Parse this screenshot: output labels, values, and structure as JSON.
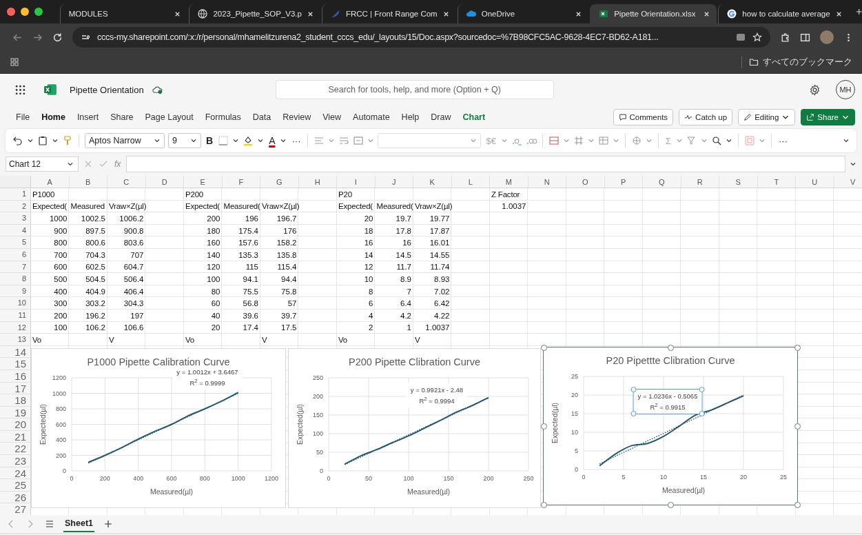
{
  "browser": {
    "tabs": [
      {
        "title": "MODULES",
        "kind": "blank",
        "selected": false
      },
      {
        "title": "2023_Pipette_SOP_V3.p",
        "kind": "globe",
        "selected": false
      },
      {
        "title": "FRCC | Front Range Com",
        "kind": "feather",
        "selected": false
      },
      {
        "title": "OneDrive",
        "kind": "cloud",
        "selected": false
      },
      {
        "title": "Pipette Orientation.xlsx",
        "kind": "excel",
        "selected": true
      },
      {
        "title": "how to calculate average",
        "kind": "google",
        "selected": false
      }
    ],
    "address": "cccs-my.sharepoint.com/:x:/r/personal/mhamelitzurena2_student_cccs_edu/_layouts/15/Doc.aspx?sourcedoc=%7B98CFC5AC-9628-4EC7-BD62-A181...",
    "bookmarks_label": "すべてのブックマーク"
  },
  "app": {
    "doc_title": "Pipette Orientation",
    "search": {
      "placeholder": "Search for tools, help, and more (Option + Q)"
    },
    "avatar": "MH",
    "menu": [
      {
        "label": "File",
        "kind": "plain",
        "selected": false
      },
      {
        "label": "Home",
        "kind": "plain",
        "selected": true
      },
      {
        "label": "Insert",
        "kind": "plain",
        "selected": false
      },
      {
        "label": "Share",
        "kind": "plain",
        "selected": false
      },
      {
        "label": "Page Layout",
        "kind": "plain",
        "selected": false
      },
      {
        "label": "Formulas",
        "kind": "plain",
        "selected": false
      },
      {
        "label": "Data",
        "kind": "plain",
        "selected": false
      },
      {
        "label": "Review",
        "kind": "plain",
        "selected": false
      },
      {
        "label": "View",
        "kind": "plain",
        "selected": false
      },
      {
        "label": "Automate",
        "kind": "plain",
        "selected": false
      },
      {
        "label": "Help",
        "kind": "plain",
        "selected": false
      },
      {
        "label": "Draw",
        "kind": "plain",
        "selected": false
      },
      {
        "label": "Chart",
        "kind": "contextual",
        "selected": false
      }
    ],
    "actions": {
      "comments": "Comments",
      "catch_up": "Catch up",
      "editing": "Editing",
      "share": "Share"
    },
    "ribbon": {
      "font": "Aptos Narrow",
      "size": "9",
      "bold_label": "B",
      "font_color_label": "A",
      "more_label": "···",
      "currency_label": "$€",
      "sum_label": "Σ",
      "more_label_end": "···"
    },
    "formula_bar": {
      "name_box": "Chart 12",
      "fx_label": "fx"
    }
  },
  "sheet": {
    "columns": [
      "A",
      "B",
      "C",
      "D",
      "E",
      "F",
      "G",
      "H",
      "I",
      "J",
      "K",
      "L",
      "M",
      "N",
      "O",
      "P",
      "Q",
      "R",
      "S",
      "T",
      "U",
      "V"
    ],
    "rows": [
      {
        "number": "1",
        "cells": [
          {
            "text": "P1000",
            "kind": "text"
          },
          null,
          null,
          null,
          {
            "text": "P200",
            "kind": "text"
          },
          null,
          null,
          null,
          {
            "text": "P20",
            "kind": "text"
          },
          null,
          null,
          null,
          {
            "text": "Z Factor",
            "kind": "text"
          }
        ]
      },
      {
        "number": "2",
        "cells": [
          {
            "text": "Expected(",
            "kind": "text"
          },
          {
            "text": "Measured",
            "kind": "text"
          },
          {
            "text": "Vraw×Z(µl)",
            "kind": "text"
          },
          null,
          {
            "text": "Expected(",
            "kind": "text"
          },
          {
            "text": "Measured(",
            "kind": "text"
          },
          {
            "text": "Vraw×Z(µl)",
            "kind": "text"
          },
          null,
          {
            "text": "Expected(",
            "kind": "text"
          },
          {
            "text": "Measured(",
            "kind": "text"
          },
          {
            "text": "Vraw×Z(µl)",
            "kind": "text"
          },
          null,
          {
            "text": "1.0037",
            "kind": "number"
          }
        ]
      },
      {
        "number": "3",
        "cells": [
          {
            "text": "1000",
            "kind": "number"
          },
          {
            "text": "1002.5",
            "kind": "number"
          },
          {
            "text": "1006.2",
            "kind": "number"
          },
          null,
          {
            "text": "200",
            "kind": "number"
          },
          {
            "text": "196",
            "kind": "number"
          },
          {
            "text": "196.7",
            "kind": "number"
          },
          null,
          {
            "text": "20",
            "kind": "number"
          },
          {
            "text": "19.7",
            "kind": "number"
          },
          {
            "text": "19.77",
            "kind": "number"
          }
        ]
      },
      {
        "number": "4",
        "cells": [
          {
            "text": "900",
            "kind": "number"
          },
          {
            "text": "897.5",
            "kind": "number"
          },
          {
            "text": "900.8",
            "kind": "number"
          },
          null,
          {
            "text": "180",
            "kind": "number"
          },
          {
            "text": "175.4",
            "kind": "number"
          },
          {
            "text": "176",
            "kind": "number"
          },
          null,
          {
            "text": "18",
            "kind": "number"
          },
          {
            "text": "17.8",
            "kind": "number"
          },
          {
            "text": "17.87",
            "kind": "number"
          }
        ]
      },
      {
        "number": "5",
        "cells": [
          {
            "text": "800",
            "kind": "number"
          },
          {
            "text": "800.6",
            "kind": "number"
          },
          {
            "text": "803.6",
            "kind": "number"
          },
          null,
          {
            "text": "160",
            "kind": "number"
          },
          {
            "text": "157.6",
            "kind": "number"
          },
          {
            "text": "158.2",
            "kind": "number"
          },
          null,
          {
            "text": "16",
            "kind": "number"
          },
          {
            "text": "16",
            "kind": "number"
          },
          {
            "text": "16.01",
            "kind": "number"
          }
        ]
      },
      {
        "number": "6",
        "cells": [
          {
            "text": "700",
            "kind": "number"
          },
          {
            "text": "704.3",
            "kind": "number"
          },
          {
            "text": "707",
            "kind": "number"
          },
          null,
          {
            "text": "140",
            "kind": "number"
          },
          {
            "text": "135.3",
            "kind": "number"
          },
          {
            "text": "135.8",
            "kind": "number"
          },
          null,
          {
            "text": "14",
            "kind": "number"
          },
          {
            "text": "14.5",
            "kind": "number"
          },
          {
            "text": "14.55",
            "kind": "number"
          }
        ]
      },
      {
        "number": "7",
        "cells": [
          {
            "text": "600",
            "kind": "number"
          },
          {
            "text": "602.5",
            "kind": "number"
          },
          {
            "text": "604.7",
            "kind": "number"
          },
          null,
          {
            "text": "120",
            "kind": "number"
          },
          {
            "text": "115",
            "kind": "number"
          },
          {
            "text": "115.4",
            "kind": "number"
          },
          null,
          {
            "text": "12",
            "kind": "number"
          },
          {
            "text": "11.7",
            "kind": "number"
          },
          {
            "text": "11.74",
            "kind": "number"
          }
        ]
      },
      {
        "number": "8",
        "cells": [
          {
            "text": "500",
            "kind": "number"
          },
          {
            "text": "504.5",
            "kind": "number"
          },
          {
            "text": "506.4",
            "kind": "number"
          },
          null,
          {
            "text": "100",
            "kind": "number"
          },
          {
            "text": "94.1",
            "kind": "number"
          },
          {
            "text": "94.4",
            "kind": "number"
          },
          null,
          {
            "text": "10",
            "kind": "number"
          },
          {
            "text": "8.9",
            "kind": "number"
          },
          {
            "text": "8.93",
            "kind": "number"
          }
        ]
      },
      {
        "number": "9",
        "cells": [
          {
            "text": "400",
            "kind": "number"
          },
          {
            "text": "404.9",
            "kind": "number"
          },
          {
            "text": "406.4",
            "kind": "number"
          },
          null,
          {
            "text": "80",
            "kind": "number"
          },
          {
            "text": "75.5",
            "kind": "number"
          },
          {
            "text": "75.8",
            "kind": "number"
          },
          null,
          {
            "text": "8",
            "kind": "number"
          },
          {
            "text": "7",
            "kind": "number"
          },
          {
            "text": "7.02",
            "kind": "number"
          }
        ]
      },
      {
        "number": "10",
        "cells": [
          {
            "text": "300",
            "kind": "number"
          },
          {
            "text": "303.2",
            "kind": "number"
          },
          {
            "text": "304.3",
            "kind": "number"
          },
          null,
          {
            "text": "60",
            "kind": "number"
          },
          {
            "text": "56.8",
            "kind": "number"
          },
          {
            "text": "57",
            "kind": "number"
          },
          null,
          {
            "text": "6",
            "kind": "number"
          },
          {
            "text": "6.4",
            "kind": "number"
          },
          {
            "text": "6.42",
            "kind": "number"
          }
        ]
      },
      {
        "number": "11",
        "cells": [
          {
            "text": "200",
            "kind": "number"
          },
          {
            "text": "196.2",
            "kind": "number"
          },
          {
            "text": "197",
            "kind": "number"
          },
          null,
          {
            "text": "40",
            "kind": "number"
          },
          {
            "text": "39.6",
            "kind": "number"
          },
          {
            "text": "39.7",
            "kind": "number"
          },
          null,
          {
            "text": "4",
            "kind": "number"
          },
          {
            "text": "4.2",
            "kind": "number"
          },
          {
            "text": "4.22",
            "kind": "number"
          }
        ]
      },
      {
        "number": "12",
        "cells": [
          {
            "text": "100",
            "kind": "number"
          },
          {
            "text": "106.2",
            "kind": "number"
          },
          {
            "text": "106.6",
            "kind": "number"
          },
          null,
          {
            "text": "20",
            "kind": "number"
          },
          {
            "text": "17.4",
            "kind": "number"
          },
          {
            "text": "17.5",
            "kind": "number"
          },
          null,
          {
            "text": "2",
            "kind": "number"
          },
          {
            "text": "1",
            "kind": "number"
          },
          {
            "text": "1.0037",
            "kind": "number"
          }
        ]
      },
      {
        "number": "13",
        "cells": [
          {
            "text": "Vo",
            "kind": "text"
          },
          null,
          {
            "text": "V",
            "kind": "text"
          },
          null,
          {
            "text": "Vo",
            "kind": "text"
          },
          null,
          {
            "text": "V",
            "kind": "text"
          },
          null,
          {
            "text": "Vo",
            "kind": "text"
          },
          null,
          {
            "text": "V",
            "kind": "text"
          }
        ]
      },
      {
        "number": "14"
      },
      {
        "number": "15"
      },
      {
        "number": "16"
      },
      {
        "number": "17"
      },
      {
        "number": "18"
      },
      {
        "number": "19"
      },
      {
        "number": "20"
      },
      {
        "number": "21"
      },
      {
        "number": "22"
      },
      {
        "number": "23"
      },
      {
        "number": "24"
      },
      {
        "number": "25"
      },
      {
        "number": "26"
      },
      {
        "number": "27"
      }
    ],
    "charts": [
      {
        "selected": false,
        "label_selected": false,
        "chart_data": {
          "type": "line",
          "title": "P1000 Pipette Calibration Curve",
          "xlabel": "Measured(µl)",
          "ylabel": "Expected(µl)",
          "x": [
            100,
            200,
            300,
            400,
            500,
            600,
            700,
            800,
            900,
            1000
          ],
          "series": [
            {
              "color": "#245873",
              "values": [
                110,
                200,
                300,
                410,
                510,
                600,
                710,
                800,
                900,
                1010
              ]
            },
            {
              "line_style": "dotted",
              "color": "#245873",
              "values": [
                100,
                200,
                300,
                400,
                500,
                600,
                700,
                800,
                900,
                1000
              ]
            }
          ],
          "grid": true,
          "xlim": [
            0,
            1200
          ],
          "ylim": [
            0,
            1200
          ],
          "xticks": [
            0,
            200,
            400,
            600,
            800,
            1000,
            1200
          ],
          "yticks": [
            0,
            200,
            400,
            600,
            800,
            1000,
            1200
          ],
          "annotations": [
            "y = 1.0012x + 3.6467",
            "R$^{2}$ = 0.9999"
          ]
        }
      },
      {
        "selected": false,
        "label_selected": false,
        "chart_data": {
          "type": "line",
          "title": "P200 Pipette Clibration Curve",
          "xlabel": "Measured(µl)",
          "ylabel": "Expected(µl)",
          "x": [
            20,
            40,
            60,
            80,
            100,
            120,
            140,
            160,
            180,
            200
          ],
          "series": [
            {
              "color": "#245873",
              "values": [
                18,
                40,
                57,
                76,
                94,
                115,
                136,
                158,
                176,
                197
              ]
            },
            {
              "line_style": "dotted",
              "color": "#245873",
              "values": [
                17,
                37,
                57,
                77,
                97,
                117,
                136,
                156,
                176,
                196
              ]
            }
          ],
          "grid": true,
          "xlim": [
            0,
            250
          ],
          "ylim": [
            0,
            250
          ],
          "xticks": [
            0,
            50,
            100,
            150,
            200,
            250
          ],
          "yticks": [
            0,
            50,
            100,
            150,
            200,
            250
          ],
          "annotations": [
            "y = 0.9921x - 2.48",
            "R$^{2}$ = 0.9994"
          ]
        }
      },
      {
        "selected": true,
        "label_selected": true,
        "chart_data": {
          "type": "line",
          "title": "P20 Pipettte Clibration Curve",
          "xlabel": "Measured(µl)",
          "ylabel": "Expected(µl)",
          "x": [
            2,
            4,
            6,
            8,
            10,
            12,
            14,
            16,
            18,
            20
          ],
          "series": [
            {
              "color": "#245873",
              "values": [
                1.0,
                4.2,
                6.4,
                7.0,
                8.9,
                11.7,
                14.6,
                16.0,
                17.9,
                19.8
              ]
            },
            {
              "line_style": "dotted",
              "color": "#245873",
              "values": [
                1.5,
                3.6,
                5.6,
                7.7,
                9.7,
                11.8,
                13.8,
                15.9,
                17.9,
                20.0
              ]
            }
          ],
          "grid": true,
          "xlim": [
            0,
            25
          ],
          "ylim": [
            0,
            25
          ],
          "xticks": [
            0,
            5,
            10,
            15,
            20,
            25
          ],
          "yticks": [
            0,
            5,
            10,
            15,
            20,
            25
          ],
          "annotations": [
            "y = 1.0236x - 0.5065",
            "R$^{2}$ = 0.9915"
          ]
        }
      }
    ]
  },
  "sheet_tabs": [
    {
      "label": "Sheet1",
      "selected": true
    }
  ]
}
